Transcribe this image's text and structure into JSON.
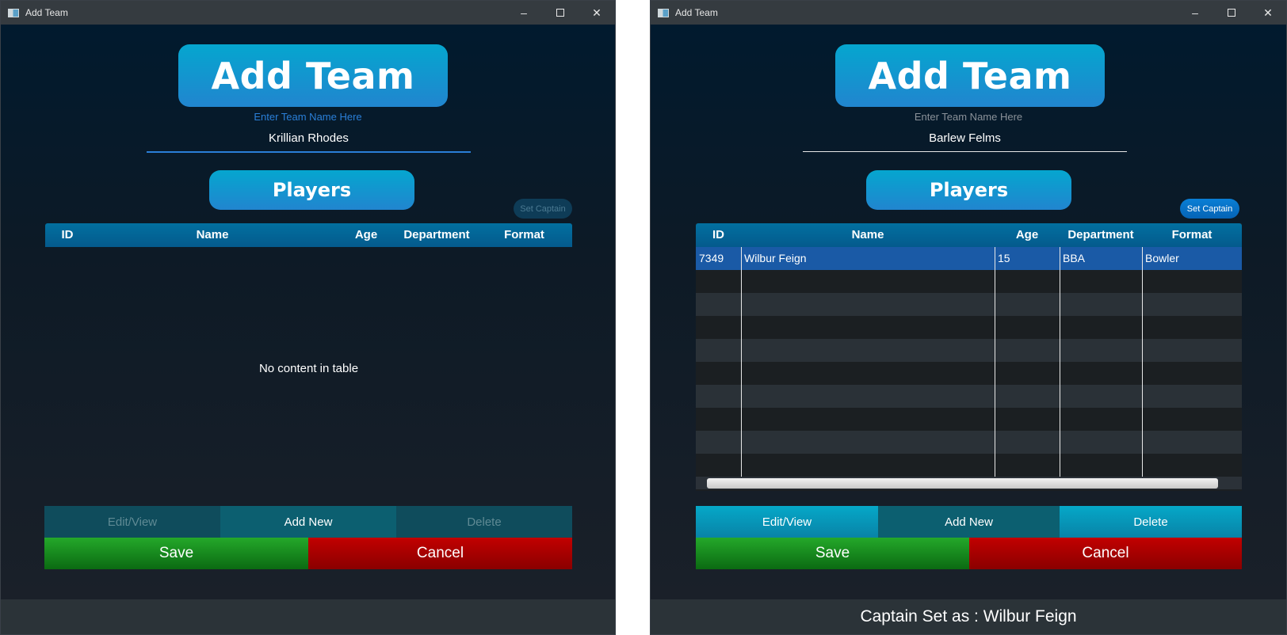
{
  "left": {
    "window_title": "Add Team",
    "header": "Add Team",
    "team_label": "Enter Team Name Here",
    "team_value": "Krillian Rhodes",
    "players_label": "Players",
    "set_captain": "Set Captain",
    "columns": [
      "ID",
      "Name",
      "Age",
      "Department",
      "Format"
    ],
    "empty_message": "No content in table",
    "actions": {
      "edit": "Edit/View",
      "add": "Add New",
      "delete": "Delete"
    },
    "save": "Save",
    "cancel": "Cancel",
    "status": ""
  },
  "right": {
    "window_title": "Add Team",
    "header": "Add Team",
    "team_label": "Enter Team Name Here",
    "team_value": "Barlew Felms",
    "players_label": "Players",
    "set_captain": "Set Captain",
    "columns": [
      "ID",
      "Name",
      "Age",
      "Department",
      "Format"
    ],
    "rows": [
      {
        "id": "7349",
        "name": "Wilbur Feign",
        "age": "15",
        "department": "BBA",
        "format": "Bowler"
      }
    ],
    "actions": {
      "edit": "Edit/View",
      "add": "Add New",
      "delete": "Delete"
    },
    "save": "Save",
    "cancel": "Cancel",
    "status": "Captain Set as : Wilbur Feign"
  },
  "colors": {
    "accent_blue": "#2185cf",
    "focus_blue": "#2a7fd8",
    "selected_row": "#1a5aa6",
    "save_green": "#1b8f22",
    "cancel_red": "#b00000"
  }
}
